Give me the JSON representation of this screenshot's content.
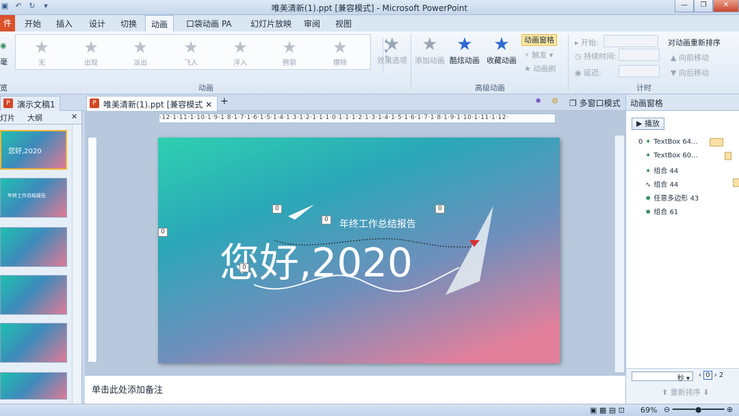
{
  "window": {
    "title": "唯美清新(1).ppt [兼容模式]  -  Microsoft PowerPoint",
    "controls": [
      "—",
      "❐",
      "✕"
    ]
  },
  "ribbon_tabs": {
    "file": "件",
    "items": [
      "开始",
      "插入",
      "设计",
      "切换",
      "动画",
      "口袋动画 PA",
      "幻灯片放映",
      "审阅",
      "视图"
    ],
    "active": "动画"
  },
  "animation_gallery": {
    "items": [
      "无",
      "出现",
      "淡出",
      "飞入",
      "浮入",
      "劈裂",
      "擦除"
    ],
    "effect_options": "效果选项",
    "group_label": "动画"
  },
  "advanced": {
    "add_animation": "添加动画",
    "cool_animation": "酷炫动画",
    "fav_animation": "收藏动画",
    "pane_button": "动画窗格",
    "trigger": "触发",
    "painter": "动画刷",
    "group_label": "高级动画"
  },
  "timing": {
    "start_label": "开始:",
    "duration_label": "持续时间:",
    "delay_label": "延迟:",
    "reorder_title": "对动画重新排序",
    "move_earlier": "向前移动",
    "move_later": "向后移动",
    "group_label": "计时"
  },
  "left_partial": {
    "top": "毫",
    "bottom": "览"
  },
  "doc_tabs": {
    "tab1": "演示文稿1",
    "tab2": "唯美清新(1).ppt [兼容模式",
    "multi_window": "多窗口模式"
  },
  "thumbs_panel": {
    "tab_slides": "灯片",
    "tab_outline": "大纲",
    "thumb1_text": "您好,2020",
    "thumb2_text": "年终工作总结报告"
  },
  "ruler": {
    "text": "·12·1·11·1·10·1·9·1·8·1·7·1·6·1·5·1·4·1·3·1·2·1·1·1·0·1·1·1·2·1·3·1·4·1·5·1·6·1·7·1·8·1·9·1·10·1·11·1·12·"
  },
  "slide": {
    "subtitle": "年终工作总结报告",
    "title": "您好,2020",
    "anim_tags": [
      "0",
      "0",
      "0",
      "0",
      "0"
    ]
  },
  "notes": {
    "placeholder": "单击此处添加备注"
  },
  "anim_pane": {
    "title": "动画窗格",
    "play": "▶ 播放",
    "items": [
      {
        "num": "0",
        "name": "TextBox 64..."
      },
      {
        "num": "",
        "name": "TextBox 60..."
      },
      {
        "num": "",
        "name": "组合 44"
      },
      {
        "num": "",
        "name": "组合 44"
      },
      {
        "num": "",
        "name": "任意多边形 43"
      },
      {
        "num": "",
        "name": "组合 61"
      }
    ],
    "seconds": "秒",
    "timeline_0": "0",
    "timeline_2": "2",
    "reorder": "重新排序"
  },
  "status": {
    "zoom": "69%"
  }
}
